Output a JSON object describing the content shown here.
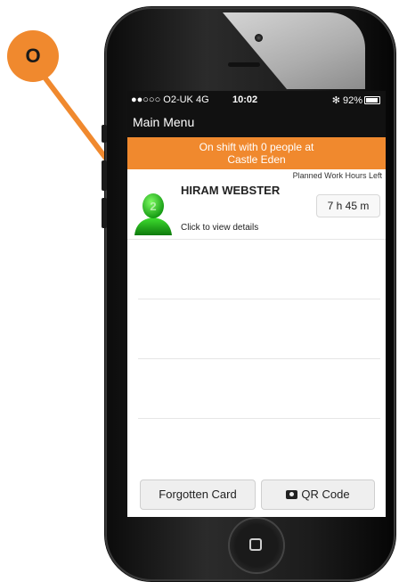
{
  "annotation": {
    "label": "O",
    "color": "#f0892e"
  },
  "statusbar": {
    "carrier": "●●○○○ O2-UK  4G",
    "time": "10:02",
    "battery": "✻ 92%"
  },
  "navbar": {
    "title": "Main Menu"
  },
  "banner": {
    "line1": "On shift with 0 people at",
    "line2": "Castle Eden",
    "color": "#f0892e"
  },
  "employee": {
    "name": "HIRAM WEBSTER",
    "planned_label": "Planned Work Hours Left",
    "hours_left": "7 h 45 m",
    "details_link": "Click to view details",
    "avatar_badge": "2",
    "avatar_icon": "person-icon"
  },
  "buttons": {
    "forgotten_card": "Forgotten Card",
    "qr_code": "QR Code"
  }
}
